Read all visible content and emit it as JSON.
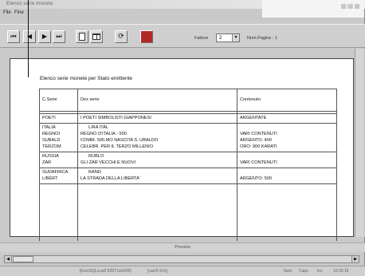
{
  "window": {
    "title": "Elenco serie monete",
    "controls": [
      "–",
      "□",
      "×"
    ]
  },
  "menu": [
    "File",
    "Fine"
  ],
  "toolbar": {
    "zoom_label": "Fattore",
    "zoom_value": "2",
    "pages_label": "Num.Pagine : 1"
  },
  "report": {
    "title": "Elenco serie monete per Stato emittente",
    "headers": [
      "C.Serie",
      "Des serie",
      "Contenuto"
    ],
    "groups": [
      {
        "rows": [
          [
            "POETI",
            "I POETI SIMBOLISTI GIAPPONESI",
            "ARGENTATE"
          ]
        ]
      },
      {
        "rows": [
          [
            "ITALIA",
            "LIRA ITAL",
            ""
          ],
          [
            "REGNOI",
            "REGNO D'ITALIA - 500",
            "VARI CONTENUTI"
          ],
          [
            "SUBALD",
            "COMM. 500.MO NASCITA S. UBALDO",
            "ARGENTO: 400"
          ],
          [
            "TERZOM",
            "CELEBR. PER IL TERZO MILLENIO",
            "ORO: 900 KARATI"
          ]
        ]
      },
      {
        "rows": [
          [
            "RUSSIA",
            "RUBLO",
            ""
          ],
          [
            "ZAR",
            "GLI ZAR VECCHI E NUOVI",
            "VARI CONTENUTI"
          ]
        ]
      },
      {
        "rows": [
          [
            "SUDAFRICA",
            "RAND",
            ""
          ],
          [
            "LIBERT",
            "LA STRADA DELLA LIBERTA'",
            "ARGENTO: 500"
          ]
        ]
      }
    ]
  },
  "preview_label": "Preview",
  "status": {
    "left": "[EuroSQLa.pdf 528T1w6000]",
    "middle": "[can/0 Zr/s]",
    "right_items": [
      "Num",
      "Caps",
      "Ins"
    ],
    "time": "10:33:18"
  },
  "colors": {
    "stop_button": "#b22a25"
  }
}
